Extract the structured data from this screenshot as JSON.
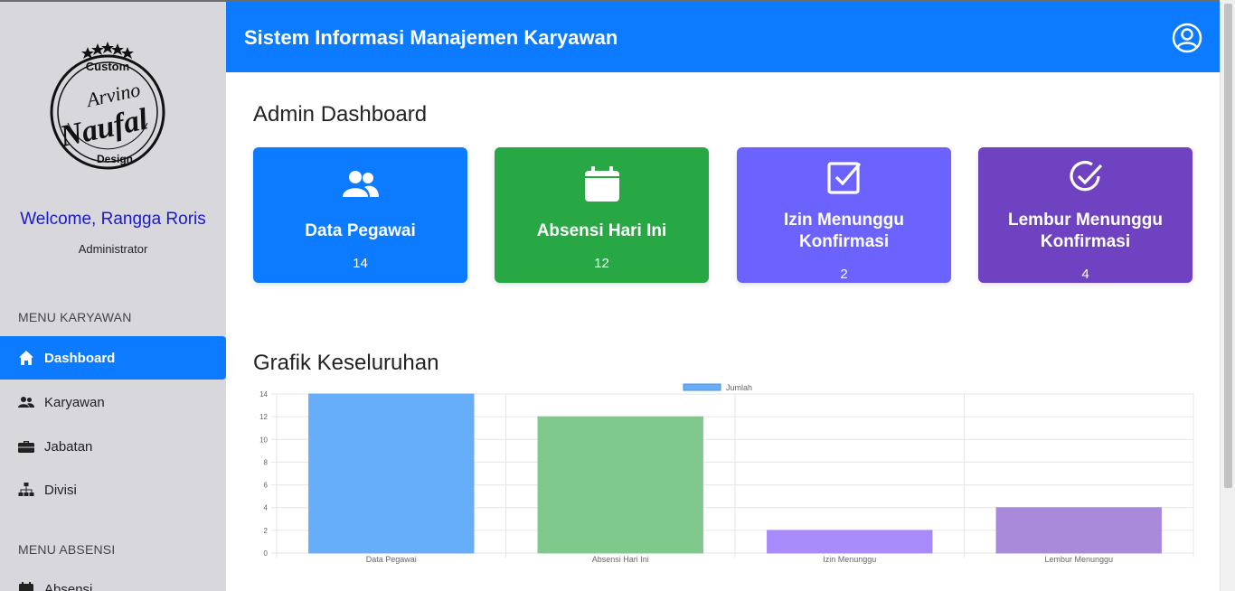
{
  "sidebar": {
    "logo": {
      "top_text": "Custom",
      "script_line1": "Arvino",
      "script_line2": "Naufal",
      "bottom_text": "Design"
    },
    "welcome": "Welcome, Rangga Roris",
    "role": "Administrator",
    "menu_karyawan_heading": "MENU KARYAWAN",
    "items": [
      {
        "label": "Dashboard",
        "icon": "home-icon",
        "active": true
      },
      {
        "label": "Karyawan",
        "icon": "users-icon"
      },
      {
        "label": "Jabatan",
        "icon": "briefcase-icon"
      },
      {
        "label": "Divisi",
        "icon": "sitemap-icon"
      }
    ],
    "menu_absensi_heading": "MENU ABSENSI",
    "absensi_items": [
      {
        "label": "Absensi",
        "icon": "calendar-icon"
      }
    ]
  },
  "header": {
    "title": "Sistem Informasi Manajemen Karyawan",
    "user_icon": "user-circle-icon"
  },
  "main": {
    "page_title": "Admin Dashboard",
    "cards": [
      {
        "label": "Data Pegawai",
        "value": "14",
        "icon": "users-icon",
        "color": "#0d7bff"
      },
      {
        "label": "Absensi Hari Ini",
        "value": "12",
        "icon": "calendar-icon",
        "color": "#28a745"
      },
      {
        "label": "Izin Menunggu Konfirmasi",
        "value": "2",
        "icon": "check-square-icon",
        "color": "#6c63ff"
      },
      {
        "label": "Lembur Menunggu Konfirmasi",
        "value": "4",
        "icon": "check-circle-icon",
        "color": "#6f42c1"
      }
    ],
    "chart_title": "Grafik Keseluruhan"
  },
  "chart_data": {
    "type": "bar",
    "categories": [
      "Data Pegawai",
      "Absensi Hari Ini",
      "Izin Menunggu",
      "Lembur Menunggu"
    ],
    "series": [
      {
        "name": "Jumlah",
        "values": [
          14,
          12,
          2,
          4
        ]
      }
    ],
    "colors": [
      "#66adfa",
      "#80c98d",
      "#a78bfa",
      "#a98ada"
    ],
    "yticks": [
      0,
      2,
      4,
      6,
      8,
      10,
      12,
      14
    ],
    "ylim": [
      0,
      14
    ],
    "grid": true,
    "legend": "top-center"
  }
}
